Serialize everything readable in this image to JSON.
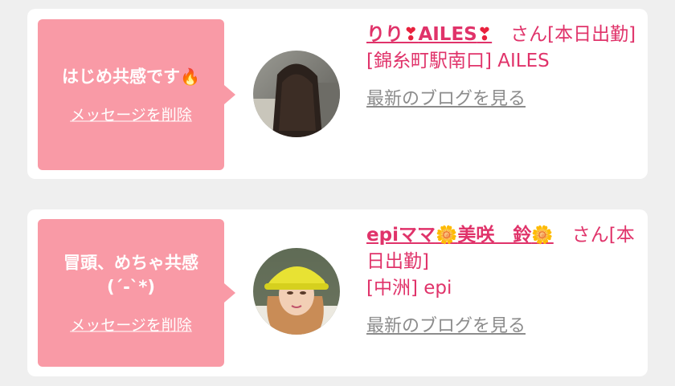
{
  "cards": [
    {
      "message": "はじめ共感です",
      "message_emoji": "🔥",
      "delete_label": "メッセージを削除",
      "name_parts": [
        "りり",
        "❣",
        "AILES",
        "❣"
      ],
      "name_suffix": "　さん[本日出勤]",
      "shop": "[錦糸町駅南口] AILES",
      "blog_label": "最新のブログを見る"
    },
    {
      "message": "冒頭、めちゃ共感",
      "message_line2": "(´-`*)",
      "delete_label": "メッセージを削除",
      "name_parts": [
        "epiママ",
        "🌼",
        "美咲　鈴",
        "🌼"
      ],
      "name_suffix": "　さん[本日出勤]",
      "shop": "[中洲] epi",
      "blog_label": "最新のブログを見る"
    }
  ],
  "colors": {
    "bubble": "#f99aa6",
    "accent": "#e0336a",
    "background": "#efefef"
  },
  "icons": {
    "fire": "fire-icon",
    "heart": "heart-exclamation-icon",
    "flower": "sunflower-icon"
  }
}
